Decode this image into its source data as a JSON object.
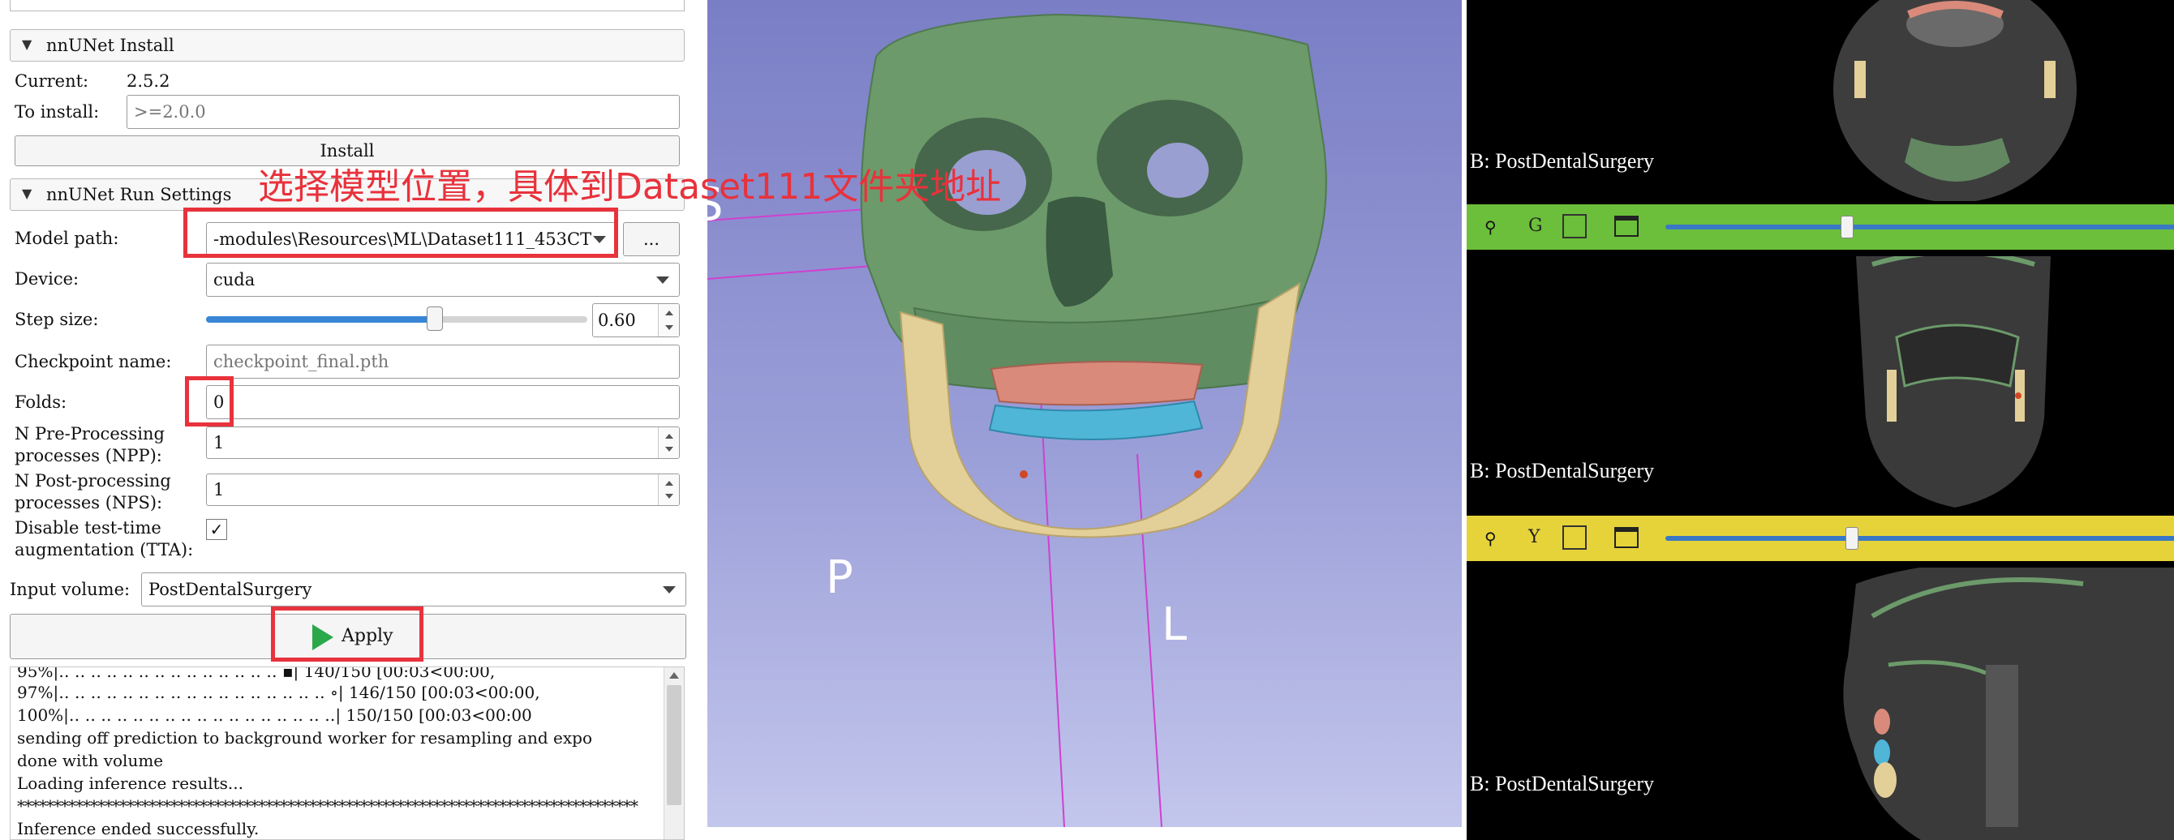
{
  "install_section": {
    "title": "nnUNet Install",
    "current_label": "Current:",
    "current_value": "2.5.2",
    "to_install_label": "To install:",
    "to_install_placeholder": ">=2.0.0",
    "install_button": "Install"
  },
  "run_settings": {
    "title": "nnUNet Run Settings",
    "model_path_label": "Model path:",
    "model_path_value": "-modules\\Resources\\ML\\Dataset111_453CT",
    "browse_button": "...",
    "device_label": "Device:",
    "device_value": "cuda",
    "step_size_label": "Step size:",
    "step_size_value": "0.60",
    "step_size_fraction": 0.6,
    "checkpoint_label": "Checkpoint name:",
    "checkpoint_placeholder": "checkpoint_final.pth",
    "folds_label": "Folds:",
    "folds_value": "0",
    "npp_label_1": "N Pre-Processing",
    "npp_label_2": "processes (NPP):",
    "npp_value": "1",
    "nps_label_1": "N Post-processing",
    "nps_label_2": "processes (NPS):",
    "nps_value": "1",
    "tta_label_1": "Disable test-time",
    "tta_label_2": "augmentation (TTA):",
    "tta_checked": true,
    "tta_check_glyph": "✓"
  },
  "input_volume": {
    "label": "Input volume:",
    "value": "PostDentalSurgery"
  },
  "apply_button": "Apply",
  "annotation": "选择模型位置，具体到Dataset111文件夹地址",
  "log_lines": [
    "95%|‥ ‥ ‥ ‥ ‥ ‥ ‥ ‥ ‥ ‥ ‥ ‥ ‥ ‥ ▪| 140/150 [00:03<00:00,",
    "97%|‥ ‥ ‥ ‥ ‥ ‥ ‥ ‥ ‥ ‥ ‥ ‥ ‥ ‥ ‥ ‥ ‥ ∘| 146/150 [00:03<00:00,",
    "100%|‥ ‥ ‥ ‥ ‥ ‥ ‥ ‥ ‥ ‥ ‥ ‥ ‥ ‥ ‥ ‥ ‥| 150/150 [00:03<00:00",
    "sending off prediction to background worker for resampling and expo",
    "done with volume",
    "Loading inference results...",
    "*************************************************************************************",
    "Inference ended successfully."
  ],
  "view3d": {
    "orientation_letters": [
      "S",
      "P",
      "L"
    ]
  },
  "slice_views": {
    "axial_label": "B: PostDentalSurgery",
    "coronal_bar_letter": "G",
    "coronal_label": "B: PostDentalSurgery",
    "coronal_slider_fraction": 0.35,
    "sagittal_bar_letter": "Y",
    "sagittal_label": "B: PostDentalSurgery",
    "sagittal_slider_fraction": 0.36
  },
  "colors": {
    "annotation_red": "#e8323c",
    "green_bar": "#6cbf3a",
    "yellow_bar": "#e6d33a",
    "skull_green": "#6c9a6a",
    "mandible_bone": "#e3cf98",
    "teeth_blue": "#4fb6d8",
    "teeth_pink": "#d98a7a",
    "apply_green": "#2aa84a"
  }
}
